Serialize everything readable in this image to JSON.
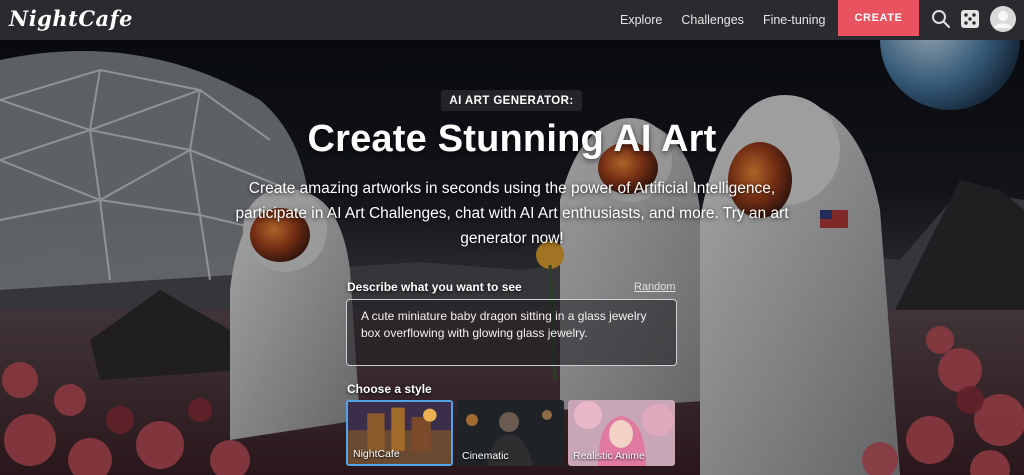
{
  "brand": {
    "logo_text": "NightCafe"
  },
  "nav": {
    "links": [
      "Explore",
      "Challenges",
      "Fine-tuning"
    ],
    "create_label": "CREATE",
    "icons": [
      "search-icon",
      "dice-icon",
      "avatar-icon"
    ]
  },
  "hero": {
    "badge": "AI ART GENERATOR:",
    "title": "Create Stunning AI Art",
    "subtitle": "Create amazing artworks in seconds using the power of Artificial Intelligence, participate in AI Art Challenges, chat with AI Art enthusiasts, and more. Try an art generator now!"
  },
  "prompt": {
    "label": "Describe what you want to see",
    "random_label": "Random",
    "value": "A cute miniature baby dragon sitting in a glass jewelry box overflowing with glowing glass jewelry."
  },
  "styles": {
    "label": "Choose a style",
    "options": [
      {
        "name": "NightCafe",
        "selected": true
      },
      {
        "name": "Cinematic",
        "selected": false
      },
      {
        "name": "Realistic Anime",
        "selected": false
      }
    ]
  },
  "colors": {
    "nav_bg": "#2a2b2f",
    "create_accent": "#e8535f",
    "selected_border": "#53a3e8"
  }
}
